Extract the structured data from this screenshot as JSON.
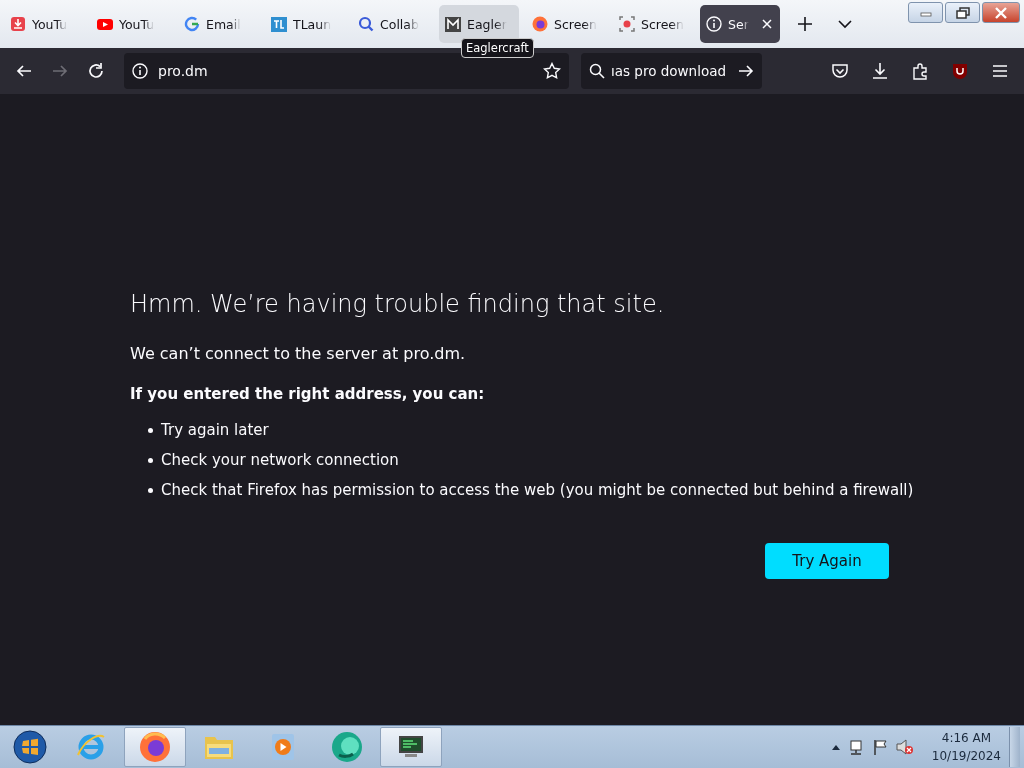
{
  "tabs": [
    {
      "kind": "download",
      "title": "YouTu",
      "selected": false,
      "hovered": false
    },
    {
      "kind": "youtube",
      "title": "YouTu",
      "selected": false,
      "hovered": false
    },
    {
      "kind": "google",
      "title": "Email",
      "selected": false,
      "hovered": false
    },
    {
      "kind": "tl",
      "title": "TLaun",
      "selected": false,
      "hovered": false
    },
    {
      "kind": "magnifier",
      "title": "Collab",
      "selected": false,
      "hovered": false
    },
    {
      "kind": "m",
      "title": "Eagler",
      "selected": false,
      "hovered": true
    },
    {
      "kind": "firefox",
      "title": "Screen",
      "selected": false,
      "hovered": false
    },
    {
      "kind": "record",
      "title": "Screen",
      "selected": false,
      "hovered": false
    },
    {
      "kind": "info",
      "title": "Ser",
      "selected": true,
      "hovered": false
    }
  ],
  "tooltip": "Eaglercraft",
  "nav": {
    "back_disabled": false,
    "forward_disabled": true,
    "url": "pro.dm",
    "search": "ıas pro download"
  },
  "error": {
    "title": "Hmm. We’re having trouble finding that site.",
    "message": "We can’t connect to the server at pro.dm.",
    "hint": "If you entered the right address, you can:",
    "items": [
      "Try again later",
      "Check your network connection",
      "Check that Firefox has permission to access the web (you might be connected but behind a firewall)"
    ],
    "button": "Try Again"
  },
  "taskbar": {
    "apps": [
      {
        "kind": "ie",
        "active": false
      },
      {
        "kind": "firefox",
        "active": true
      },
      {
        "kind": "folder",
        "active": false
      },
      {
        "kind": "media",
        "active": false
      },
      {
        "kind": "orb",
        "active": false
      },
      {
        "kind": "monitor",
        "active": true
      }
    ],
    "time": "4:16 AM",
    "date": "10/19/2024"
  }
}
